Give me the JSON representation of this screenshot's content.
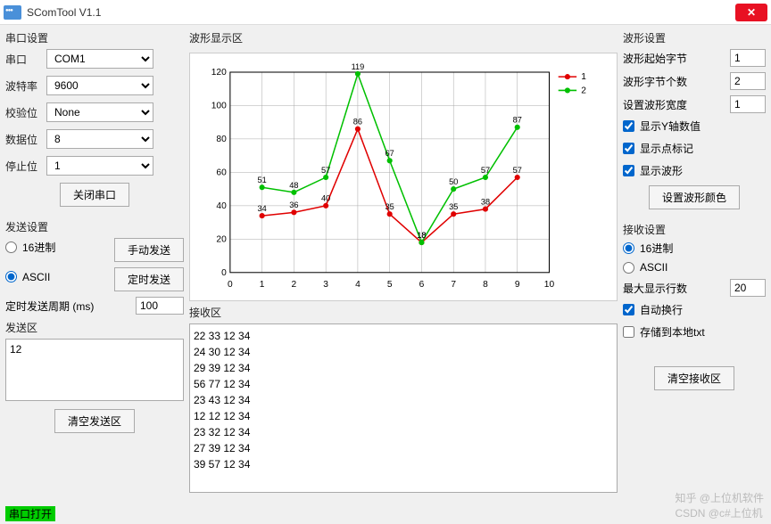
{
  "app": {
    "title": "SComTool V1.1"
  },
  "serial": {
    "group": "串口设置",
    "port_label": "串口",
    "port_value": "COM1",
    "baud_label": "波特率",
    "baud_value": "9600",
    "parity_label": "校验位",
    "parity_value": "None",
    "databits_label": "数据位",
    "databits_value": "8",
    "stopbits_label": "停止位",
    "stopbits_value": "1",
    "close_btn": "关闭串口"
  },
  "send": {
    "group": "发送设置",
    "hex_label": "16进制",
    "ascii_label": "ASCII",
    "manual_btn": "手动发送",
    "timed_btn": "定时发送",
    "period_label": "定时发送周期 (ms)",
    "period_value": "100",
    "area_label": "发送区",
    "area_value": "12",
    "clear_btn": "清空发送区"
  },
  "wave": {
    "group": "波形显示区"
  },
  "recv": {
    "group": "接收区",
    "lines": [
      "22 33 12 34",
      "24 30 12 34",
      "29 39 12 34",
      "56 77 12 34",
      "23 43 12 34",
      "12 12 12 34",
      "23 32 12 34",
      "27 39 12 34",
      "39 57 12 34"
    ]
  },
  "wave_set": {
    "group": "波形设置",
    "start_label": "波形起始字节",
    "start_value": "1",
    "count_label": "波形字节个数",
    "count_value": "2",
    "width_label": "设置波形宽度",
    "width_value": "1",
    "show_y": "显示Y轴数值",
    "show_marker": "显示点标记",
    "show_wave": "显示波形",
    "color_btn": "设置波形颜色"
  },
  "recv_set": {
    "group": "接收设置",
    "hex_label": "16进制",
    "ascii_label": "ASCII",
    "maxlines_label": "最大显示行数",
    "maxlines_value": "20",
    "autowrap": "自动换行",
    "save_txt": "存储到本地txt",
    "clear_btn": "清空接收区"
  },
  "status": {
    "open": "串口打开"
  },
  "watermark": {
    "line1": "知乎 @上位机软件",
    "line2": "CSDN @c#上位机"
  },
  "chart_data": {
    "type": "line",
    "x": [
      1,
      2,
      3,
      4,
      5,
      6,
      7,
      8,
      9
    ],
    "series": [
      {
        "name": "1",
        "color": "#e00000",
        "values": [
          34,
          36,
          40,
          86,
          35,
          18,
          35,
          38,
          57
        ]
      },
      {
        "name": "2",
        "color": "#00c000",
        "values": [
          51,
          48,
          57,
          119,
          67,
          18,
          50,
          57,
          87
        ]
      }
    ],
    "xlim": [
      0,
      10
    ],
    "ylim": [
      0,
      120
    ],
    "xticks": [
      0,
      1,
      2,
      3,
      4,
      5,
      6,
      7,
      8,
      9,
      10
    ],
    "yticks": [
      0,
      20,
      40,
      60,
      80,
      100,
      120
    ]
  }
}
